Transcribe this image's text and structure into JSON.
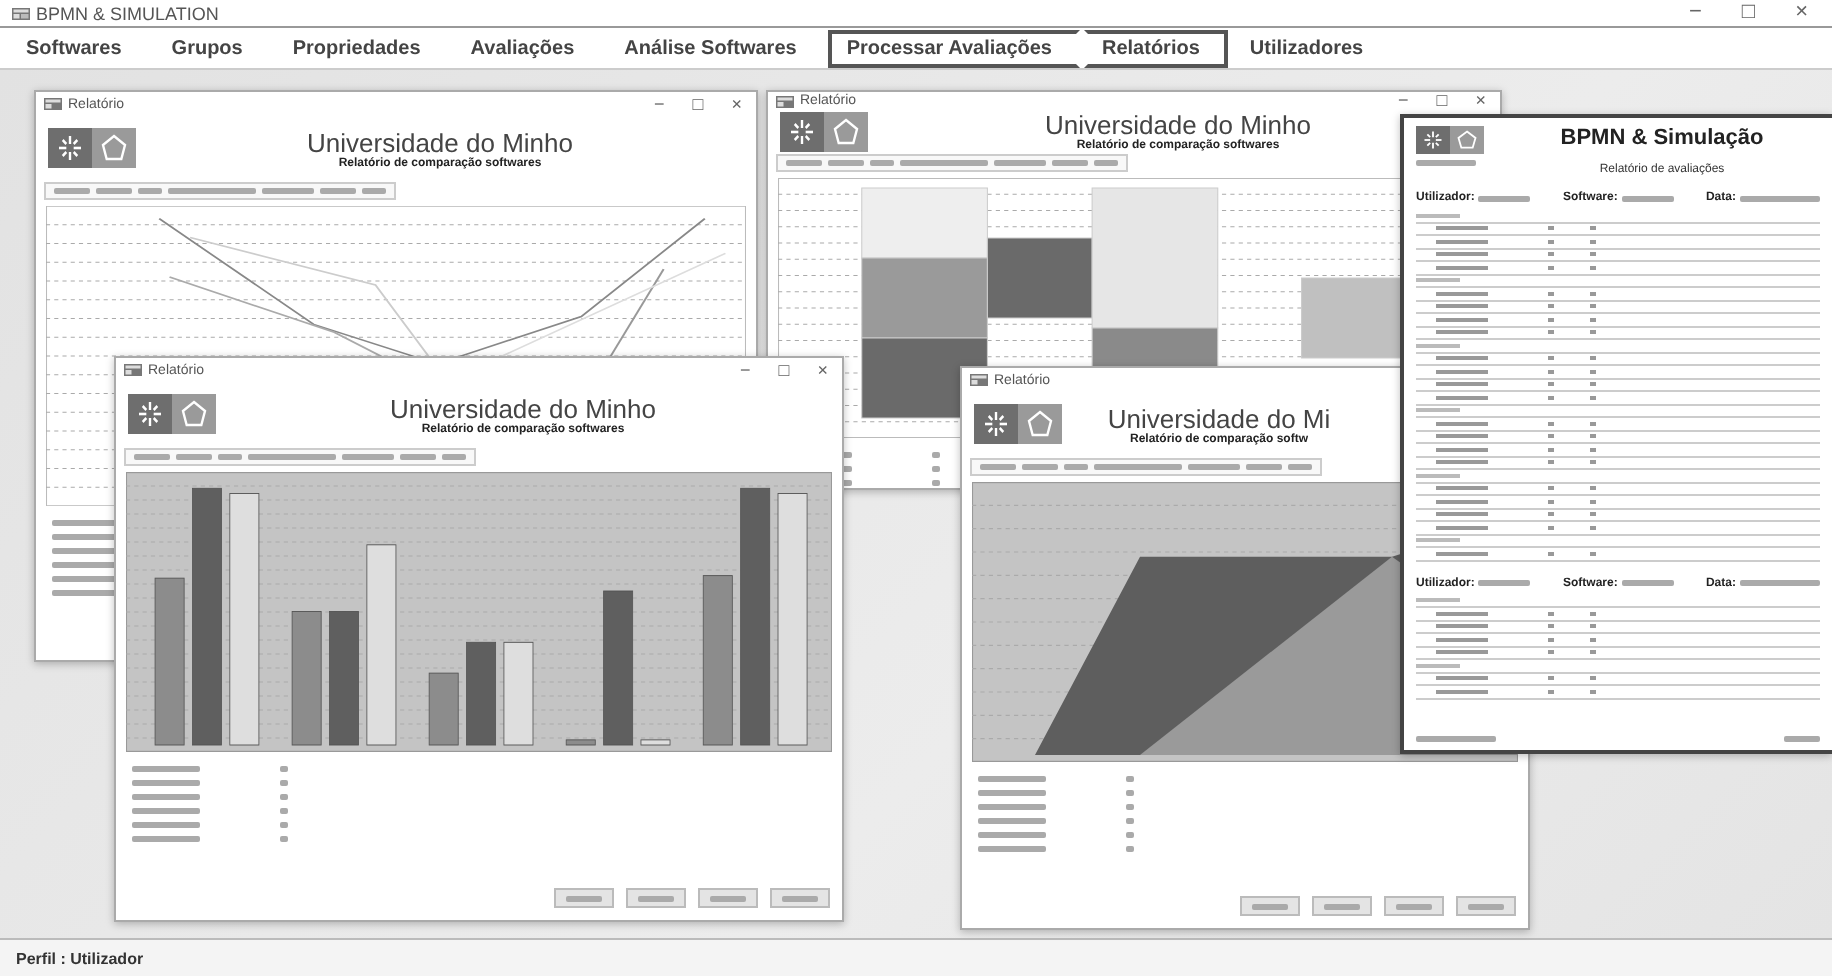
{
  "app": {
    "title": "BPMN & SIMULATION",
    "controls": [
      "−",
      "□",
      "×"
    ]
  },
  "menu": [
    {
      "label": "Softwares",
      "highlighted": false
    },
    {
      "label": "Grupos",
      "highlighted": false
    },
    {
      "label": "Propriedades",
      "highlighted": false
    },
    {
      "label": "Avaliações",
      "highlighted": false
    },
    {
      "label": "Análise Softwares",
      "highlighted": false
    },
    {
      "label": "Processar Avaliações",
      "highlighted": true
    },
    {
      "label": "Relatórios",
      "highlighted": true
    },
    {
      "label": "Utilizadores",
      "highlighted": false
    }
  ],
  "windows": [
    {
      "kind": "line",
      "title": "Relatório",
      "controls": [
        "−",
        "□",
        "×"
      ],
      "heading": "Universidade do Minho",
      "subheading": "Relatório de comparação softwares",
      "buttons": false
    },
    {
      "kind": "stacked",
      "title": "Relatório",
      "controls": [
        "−",
        "□",
        "×"
      ],
      "heading": "Universidade do Minho",
      "subheading": "Relatório de comparação softwares",
      "buttons": false
    },
    {
      "kind": "bar",
      "title": "Relatório",
      "controls": [
        "−",
        "□",
        "×"
      ],
      "heading": "Universidade do Minho",
      "subheading": "Relatório de comparação softwares",
      "buttons": true
    },
    {
      "kind": "area",
      "title": "Relatório",
      "heading": "Universidade do Mi",
      "subheading": "Relatório de comparação softw",
      "buttons": true
    }
  ],
  "report": {
    "heading": "BPMN & Simulação",
    "subheading": "Relatório de avaliações",
    "blocks": [
      {
        "user_label": "Utilizador:",
        "software_label": "Software:",
        "date_label": "Data:"
      },
      {
        "user_label": "Utilizador:",
        "software_label": "Software:",
        "date_label": "Data:"
      }
    ]
  },
  "status_bar": {
    "text": "Perfil : Utilizador"
  }
}
